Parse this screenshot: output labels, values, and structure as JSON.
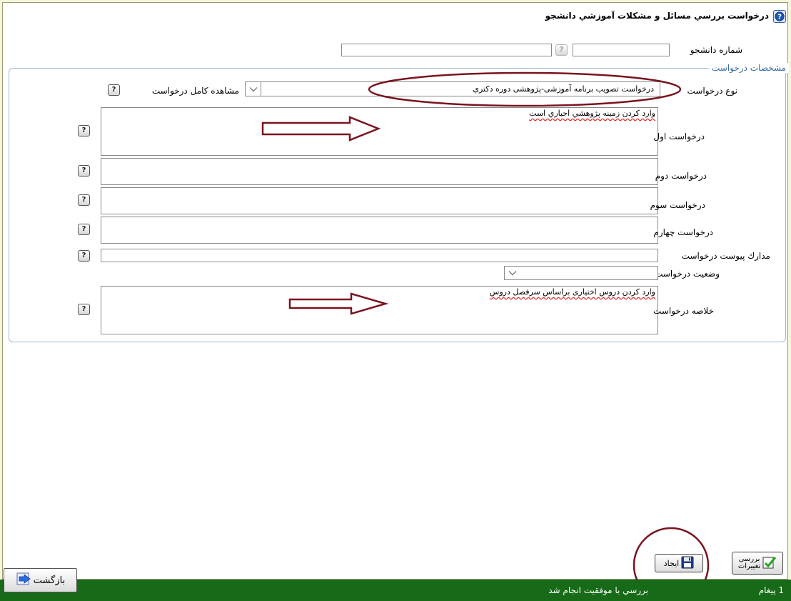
{
  "form": {
    "title": "درخواست بررسي مسائل و مشكلات آموزشي دانشجو",
    "student_number_label": "شماره دانشجو",
    "student_number_value": "",
    "student_name_value": "",
    "fieldset_legend": "مشخصات درخواست",
    "request_type_label": "نوع درخواست",
    "request_type_value": "درخواست تصويب برنامه آموزشی-پژوهشی دوره دکتري",
    "view_full_request_label": "مشاهده کامل درخواست",
    "first_request_label": "درخواست اول",
    "first_request_value": "وارد کردن زمینه پژوهشي اجباري است",
    "second_request_label": "درخواست دوم",
    "third_request_label": "درخواست سوم",
    "fourth_request_label": "درخواست چهارم",
    "attachments_label": "مدارك پيوست درخواست",
    "status_label": "وضعيت درخواست",
    "status_value": "",
    "summary_label": "خلاصه درخواست",
    "summary_value": "وارد کردن دروس اختیاری براساس سرفصل دروس"
  },
  "actions": {
    "create_label": "ایجاد",
    "review_changes_line1": "بررسی",
    "review_changes_line2": "تغییرات"
  },
  "footer": {
    "back_label": "بازگشت",
    "status_message": "بررسي با موفقيت انجام شد",
    "message_count": "1 پیغام"
  },
  "colors": {
    "annotation": "#7a1420",
    "footer_bg": "#176a17",
    "legend_text": "#3a6ea8"
  }
}
